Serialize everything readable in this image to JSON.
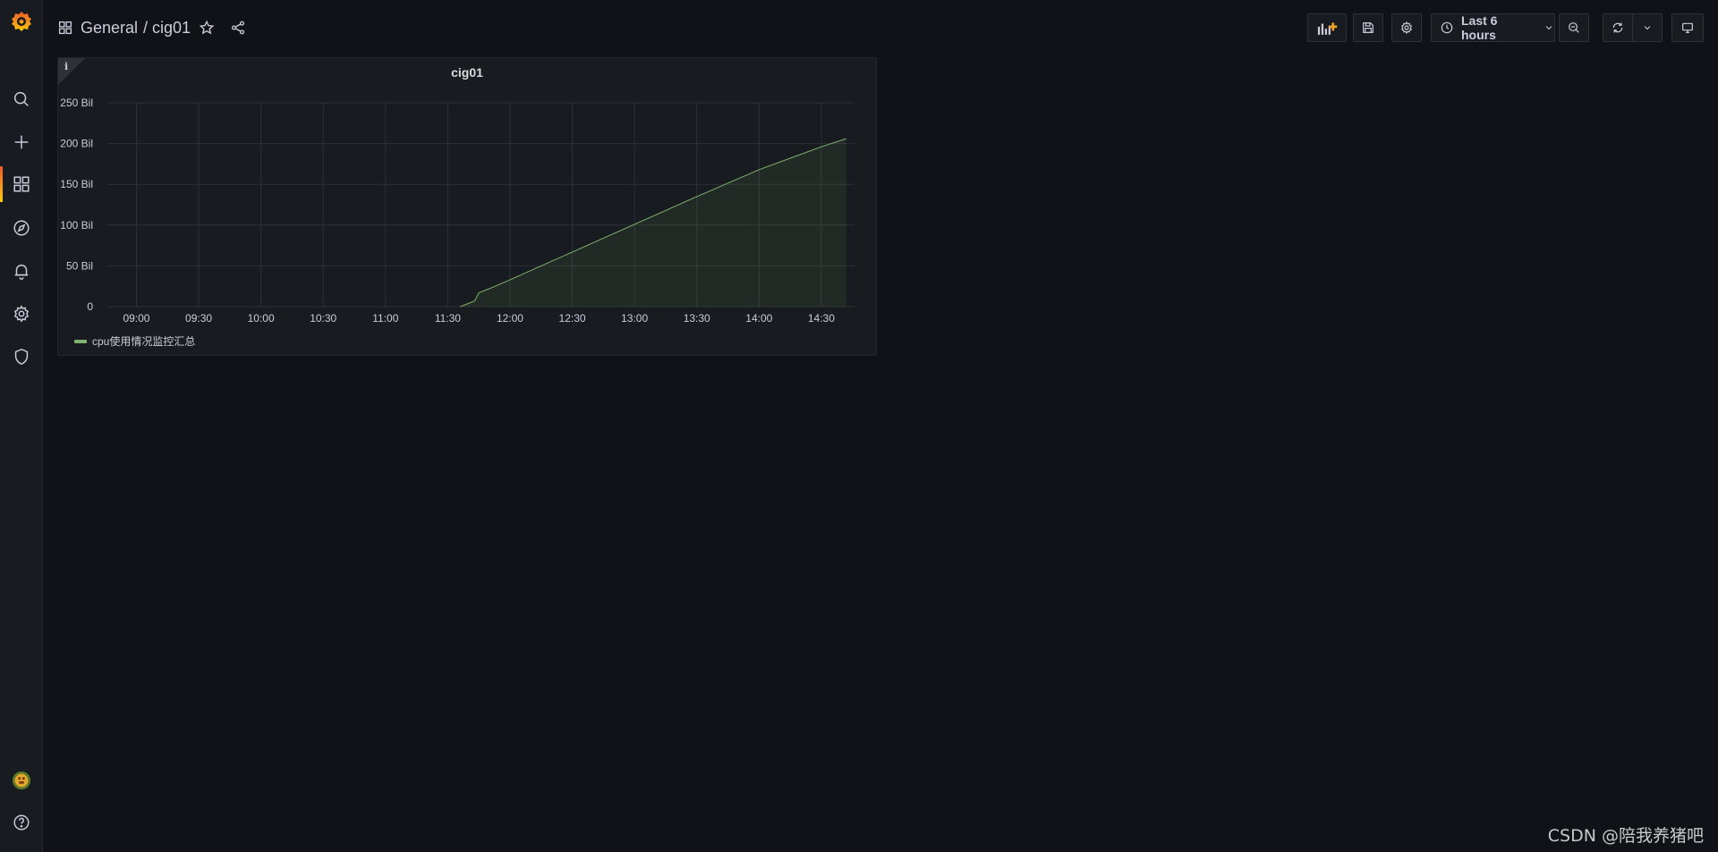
{
  "breadcrumb": {
    "folder": "General",
    "dashboard": "/ cig01"
  },
  "time_picker": {
    "label": "Last 6 hours"
  },
  "panel": {
    "title": "cig01",
    "info": "i"
  },
  "watermark": "CSDN @陪我养猪吧",
  "colors": {
    "accent": "#f05a28",
    "series": "#7eb26d",
    "background": "#111217",
    "panel": "#181b1f"
  },
  "sidebar_icons": [
    "grafana-logo-icon",
    "search-icon",
    "plus-icon",
    "dashboards-icon",
    "explore-icon",
    "alerting-icon",
    "settings-icon",
    "shield-icon",
    "avatar",
    "help-icon"
  ],
  "chart_data": {
    "type": "area",
    "title": "cig01",
    "x_ticks": [
      "09:00",
      "09:30",
      "10:00",
      "10:30",
      "11:00",
      "11:30",
      "12:00",
      "12:30",
      "13:00",
      "13:30",
      "14:00",
      "14:30"
    ],
    "y_ticks": [
      "0",
      "50 Bil",
      "100 Bil",
      "150 Bil",
      "200 Bil",
      "250 Bil"
    ],
    "ylim": [
      0,
      250
    ],
    "xlim": [
      "08:46",
      "14:46"
    ],
    "grid": true,
    "legend_position": "bottom-left",
    "series": [
      {
        "name": "cpu使用情况监控汇总",
        "color": "#7eb26d",
        "x": [
          "11:36",
          "11:40",
          "11:43",
          "11:45",
          "11:50",
          "12:00",
          "12:30",
          "13:00",
          "13:30",
          "14:00",
          "14:30",
          "14:42"
        ],
        "y": [
          0,
          4,
          7,
          17,
          22,
          33,
          67,
          101,
          135,
          168,
          196,
          206
        ]
      }
    ]
  }
}
